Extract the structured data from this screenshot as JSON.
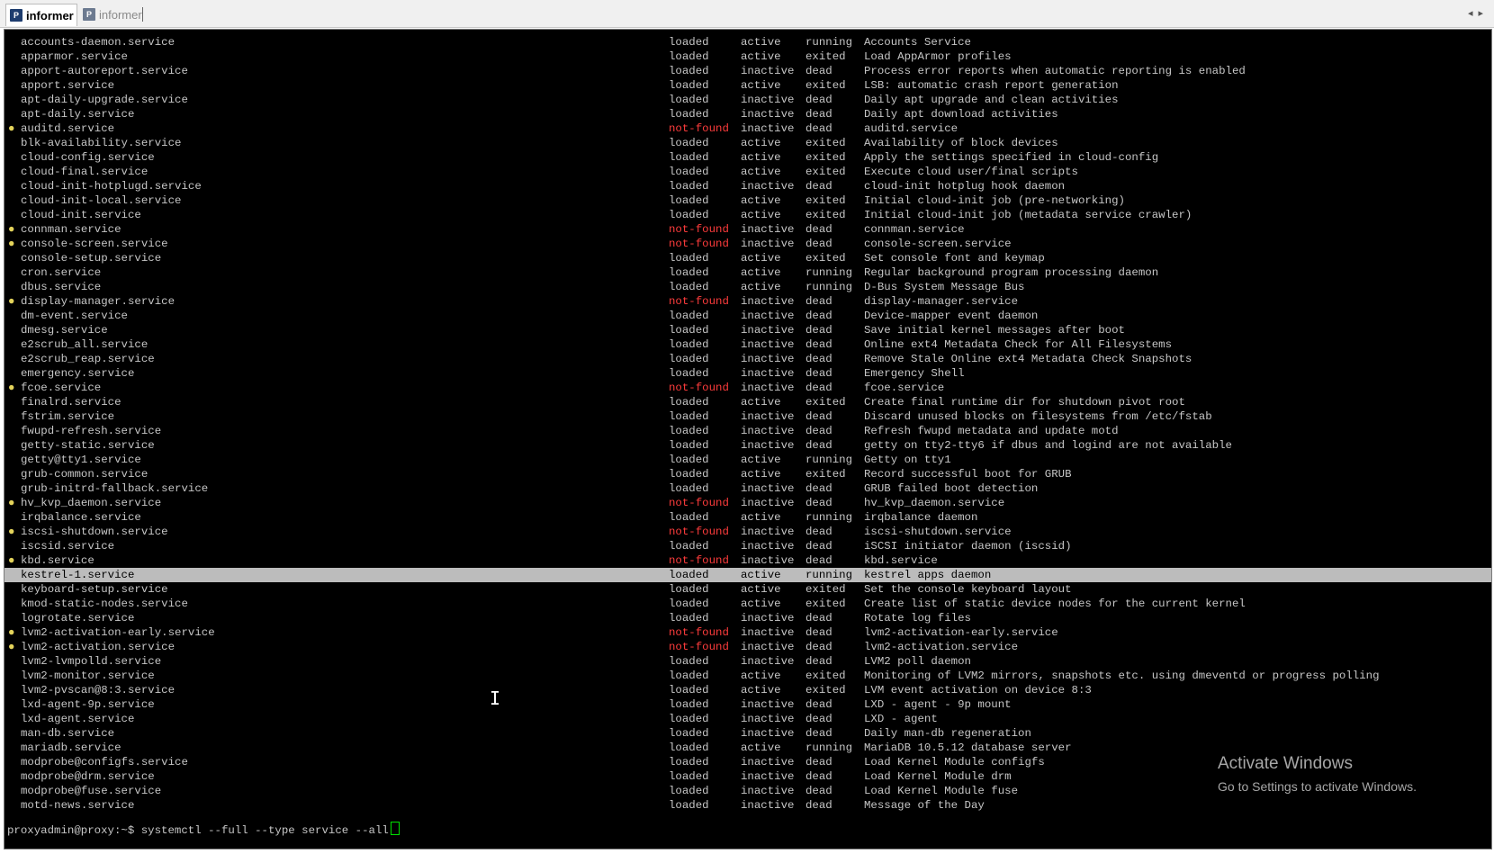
{
  "tabs": [
    {
      "label": "informer",
      "icon": "putty-icon",
      "active": true
    },
    {
      "label": "informer",
      "icon": "putty-icon",
      "active": false
    }
  ],
  "terminal": {
    "colors": {
      "background": "#000000",
      "text": "#c6c6c6",
      "not_found": "#ff3c3c",
      "bullet": "#e3d35b",
      "selection": "#bcbcbc"
    },
    "rows": [
      {
        "bullet": "",
        "unit": "accounts-daemon.service",
        "load": "loaded",
        "active": "active",
        "sub": "running",
        "description": "Accounts Service"
      },
      {
        "bullet": "",
        "unit": "apparmor.service",
        "load": "loaded",
        "active": "active",
        "sub": "exited",
        "description": "Load AppArmor profiles"
      },
      {
        "bullet": "",
        "unit": "apport-autoreport.service",
        "load": "loaded",
        "active": "inactive",
        "sub": "dead",
        "description": "Process error reports when automatic reporting is enabled"
      },
      {
        "bullet": "",
        "unit": "apport.service",
        "load": "loaded",
        "active": "active",
        "sub": "exited",
        "description": "LSB: automatic crash report generation"
      },
      {
        "bullet": "",
        "unit": "apt-daily-upgrade.service",
        "load": "loaded",
        "active": "inactive",
        "sub": "dead",
        "description": "Daily apt upgrade and clean activities"
      },
      {
        "bullet": "",
        "unit": "apt-daily.service",
        "load": "loaded",
        "active": "inactive",
        "sub": "dead",
        "description": "Daily apt download activities"
      },
      {
        "bullet": "●",
        "unit": "auditd.service",
        "load": "not-found",
        "active": "inactive",
        "sub": "dead",
        "description": "auditd.service"
      },
      {
        "bullet": "",
        "unit": "blk-availability.service",
        "load": "loaded",
        "active": "active",
        "sub": "exited",
        "description": "Availability of block devices"
      },
      {
        "bullet": "",
        "unit": "cloud-config.service",
        "load": "loaded",
        "active": "active",
        "sub": "exited",
        "description": "Apply the settings specified in cloud-config"
      },
      {
        "bullet": "",
        "unit": "cloud-final.service",
        "load": "loaded",
        "active": "active",
        "sub": "exited",
        "description": "Execute cloud user/final scripts"
      },
      {
        "bullet": "",
        "unit": "cloud-init-hotplugd.service",
        "load": "loaded",
        "active": "inactive",
        "sub": "dead",
        "description": "cloud-init hotplug hook daemon"
      },
      {
        "bullet": "",
        "unit": "cloud-init-local.service",
        "load": "loaded",
        "active": "active",
        "sub": "exited",
        "description": "Initial cloud-init job (pre-networking)"
      },
      {
        "bullet": "",
        "unit": "cloud-init.service",
        "load": "loaded",
        "active": "active",
        "sub": "exited",
        "description": "Initial cloud-init job (metadata service crawler)"
      },
      {
        "bullet": "●",
        "unit": "connman.service",
        "load": "not-found",
        "active": "inactive",
        "sub": "dead",
        "description": "connman.service"
      },
      {
        "bullet": "●",
        "unit": "console-screen.service",
        "load": "not-found",
        "active": "inactive",
        "sub": "dead",
        "description": "console-screen.service"
      },
      {
        "bullet": "",
        "unit": "console-setup.service",
        "load": "loaded",
        "active": "active",
        "sub": "exited",
        "description": "Set console font and keymap"
      },
      {
        "bullet": "",
        "unit": "cron.service",
        "load": "loaded",
        "active": "active",
        "sub": "running",
        "description": "Regular background program processing daemon"
      },
      {
        "bullet": "",
        "unit": "dbus.service",
        "load": "loaded",
        "active": "active",
        "sub": "running",
        "description": "D-Bus System Message Bus"
      },
      {
        "bullet": "●",
        "unit": "display-manager.service",
        "load": "not-found",
        "active": "inactive",
        "sub": "dead",
        "description": "display-manager.service"
      },
      {
        "bullet": "",
        "unit": "dm-event.service",
        "load": "loaded",
        "active": "inactive",
        "sub": "dead",
        "description": "Device-mapper event daemon"
      },
      {
        "bullet": "",
        "unit": "dmesg.service",
        "load": "loaded",
        "active": "inactive",
        "sub": "dead",
        "description": "Save initial kernel messages after boot"
      },
      {
        "bullet": "",
        "unit": "e2scrub_all.service",
        "load": "loaded",
        "active": "inactive",
        "sub": "dead",
        "description": "Online ext4 Metadata Check for All Filesystems"
      },
      {
        "bullet": "",
        "unit": "e2scrub_reap.service",
        "load": "loaded",
        "active": "inactive",
        "sub": "dead",
        "description": "Remove Stale Online ext4 Metadata Check Snapshots"
      },
      {
        "bullet": "",
        "unit": "emergency.service",
        "load": "loaded",
        "active": "inactive",
        "sub": "dead",
        "description": "Emergency Shell"
      },
      {
        "bullet": "●",
        "unit": "fcoe.service",
        "load": "not-found",
        "active": "inactive",
        "sub": "dead",
        "description": "fcoe.service"
      },
      {
        "bullet": "",
        "unit": "finalrd.service",
        "load": "loaded",
        "active": "active",
        "sub": "exited",
        "description": "Create final runtime dir for shutdown pivot root"
      },
      {
        "bullet": "",
        "unit": "fstrim.service",
        "load": "loaded",
        "active": "inactive",
        "sub": "dead",
        "description": "Discard unused blocks on filesystems from /etc/fstab"
      },
      {
        "bullet": "",
        "unit": "fwupd-refresh.service",
        "load": "loaded",
        "active": "inactive",
        "sub": "dead",
        "description": "Refresh fwupd metadata and update motd"
      },
      {
        "bullet": "",
        "unit": "getty-static.service",
        "load": "loaded",
        "active": "inactive",
        "sub": "dead",
        "description": "getty on tty2-tty6 if dbus and logind are not available"
      },
      {
        "bullet": "",
        "unit": "getty@tty1.service",
        "load": "loaded",
        "active": "active",
        "sub": "running",
        "description": "Getty on tty1"
      },
      {
        "bullet": "",
        "unit": "grub-common.service",
        "load": "loaded",
        "active": "active",
        "sub": "exited",
        "description": "Record successful boot for GRUB"
      },
      {
        "bullet": "",
        "unit": "grub-initrd-fallback.service",
        "load": "loaded",
        "active": "inactive",
        "sub": "dead",
        "description": "GRUB failed boot detection"
      },
      {
        "bullet": "●",
        "unit": "hv_kvp_daemon.service",
        "load": "not-found",
        "active": "inactive",
        "sub": "dead",
        "description": "hv_kvp_daemon.service"
      },
      {
        "bullet": "",
        "unit": "irqbalance.service",
        "load": "loaded",
        "active": "active",
        "sub": "running",
        "description": "irqbalance daemon"
      },
      {
        "bullet": "●",
        "unit": "iscsi-shutdown.service",
        "load": "not-found",
        "active": "inactive",
        "sub": "dead",
        "description": "iscsi-shutdown.service"
      },
      {
        "bullet": "",
        "unit": "iscsid.service",
        "load": "loaded",
        "active": "inactive",
        "sub": "dead",
        "description": "iSCSI initiator daemon (iscsid)"
      },
      {
        "bullet": "●",
        "unit": "kbd.service",
        "load": "not-found",
        "active": "inactive",
        "sub": "dead",
        "description": "kbd.service"
      },
      {
        "bullet": "",
        "unit": "kestrel-1.service",
        "load": "loaded",
        "active": "active",
        "sub": "running",
        "description": "kestrel apps daemon",
        "selected": true
      },
      {
        "bullet": "",
        "unit": "keyboard-setup.service",
        "load": "loaded",
        "active": "active",
        "sub": "exited",
        "description": "Set the console keyboard layout"
      },
      {
        "bullet": "",
        "unit": "kmod-static-nodes.service",
        "load": "loaded",
        "active": "active",
        "sub": "exited",
        "description": "Create list of static device nodes for the current kernel"
      },
      {
        "bullet": "",
        "unit": "logrotate.service",
        "load": "loaded",
        "active": "inactive",
        "sub": "dead",
        "description": "Rotate log files"
      },
      {
        "bullet": "●",
        "unit": "lvm2-activation-early.service",
        "load": "not-found",
        "active": "inactive",
        "sub": "dead",
        "description": "lvm2-activation-early.service"
      },
      {
        "bullet": "●",
        "unit": "lvm2-activation.service",
        "load": "not-found",
        "active": "inactive",
        "sub": "dead",
        "description": "lvm2-activation.service"
      },
      {
        "bullet": "",
        "unit": "lvm2-lvmpolld.service",
        "load": "loaded",
        "active": "inactive",
        "sub": "dead",
        "description": "LVM2 poll daemon"
      },
      {
        "bullet": "",
        "unit": "lvm2-monitor.service",
        "load": "loaded",
        "active": "active",
        "sub": "exited",
        "description": "Monitoring of LVM2 mirrors, snapshots etc. using dmeventd or progress polling"
      },
      {
        "bullet": "",
        "unit": "lvm2-pvscan@8:3.service",
        "load": "loaded",
        "active": "active",
        "sub": "exited",
        "description": "LVM event activation on device 8:3"
      },
      {
        "bullet": "",
        "unit": "lxd-agent-9p.service",
        "load": "loaded",
        "active": "inactive",
        "sub": "dead",
        "description": "LXD - agent - 9p mount"
      },
      {
        "bullet": "",
        "unit": "lxd-agent.service",
        "load": "loaded",
        "active": "inactive",
        "sub": "dead",
        "description": "LXD - agent"
      },
      {
        "bullet": "",
        "unit": "man-db.service",
        "load": "loaded",
        "active": "inactive",
        "sub": "dead",
        "description": "Daily man-db regeneration"
      },
      {
        "bullet": "",
        "unit": "mariadb.service",
        "load": "loaded",
        "active": "active",
        "sub": "running",
        "description": "MariaDB 10.5.12 database server"
      },
      {
        "bullet": "",
        "unit": "modprobe@configfs.service",
        "load": "loaded",
        "active": "inactive",
        "sub": "dead",
        "description": "Load Kernel Module configfs"
      },
      {
        "bullet": "",
        "unit": "modprobe@drm.service",
        "load": "loaded",
        "active": "inactive",
        "sub": "dead",
        "description": "Load Kernel Module drm"
      },
      {
        "bullet": "",
        "unit": "modprobe@fuse.service",
        "load": "loaded",
        "active": "inactive",
        "sub": "dead",
        "description": "Load Kernel Module fuse"
      },
      {
        "bullet": "",
        "unit": "motd-news.service",
        "load": "loaded",
        "active": "inactive",
        "sub": "dead",
        "description": "Message of the Day"
      }
    ],
    "prompt": "proxyadmin@proxy:~$ ",
    "command": "systemctl --full --type service --all"
  },
  "watermark": {
    "title": "Activate Windows",
    "subtitle": "Go to Settings to activate Windows."
  }
}
